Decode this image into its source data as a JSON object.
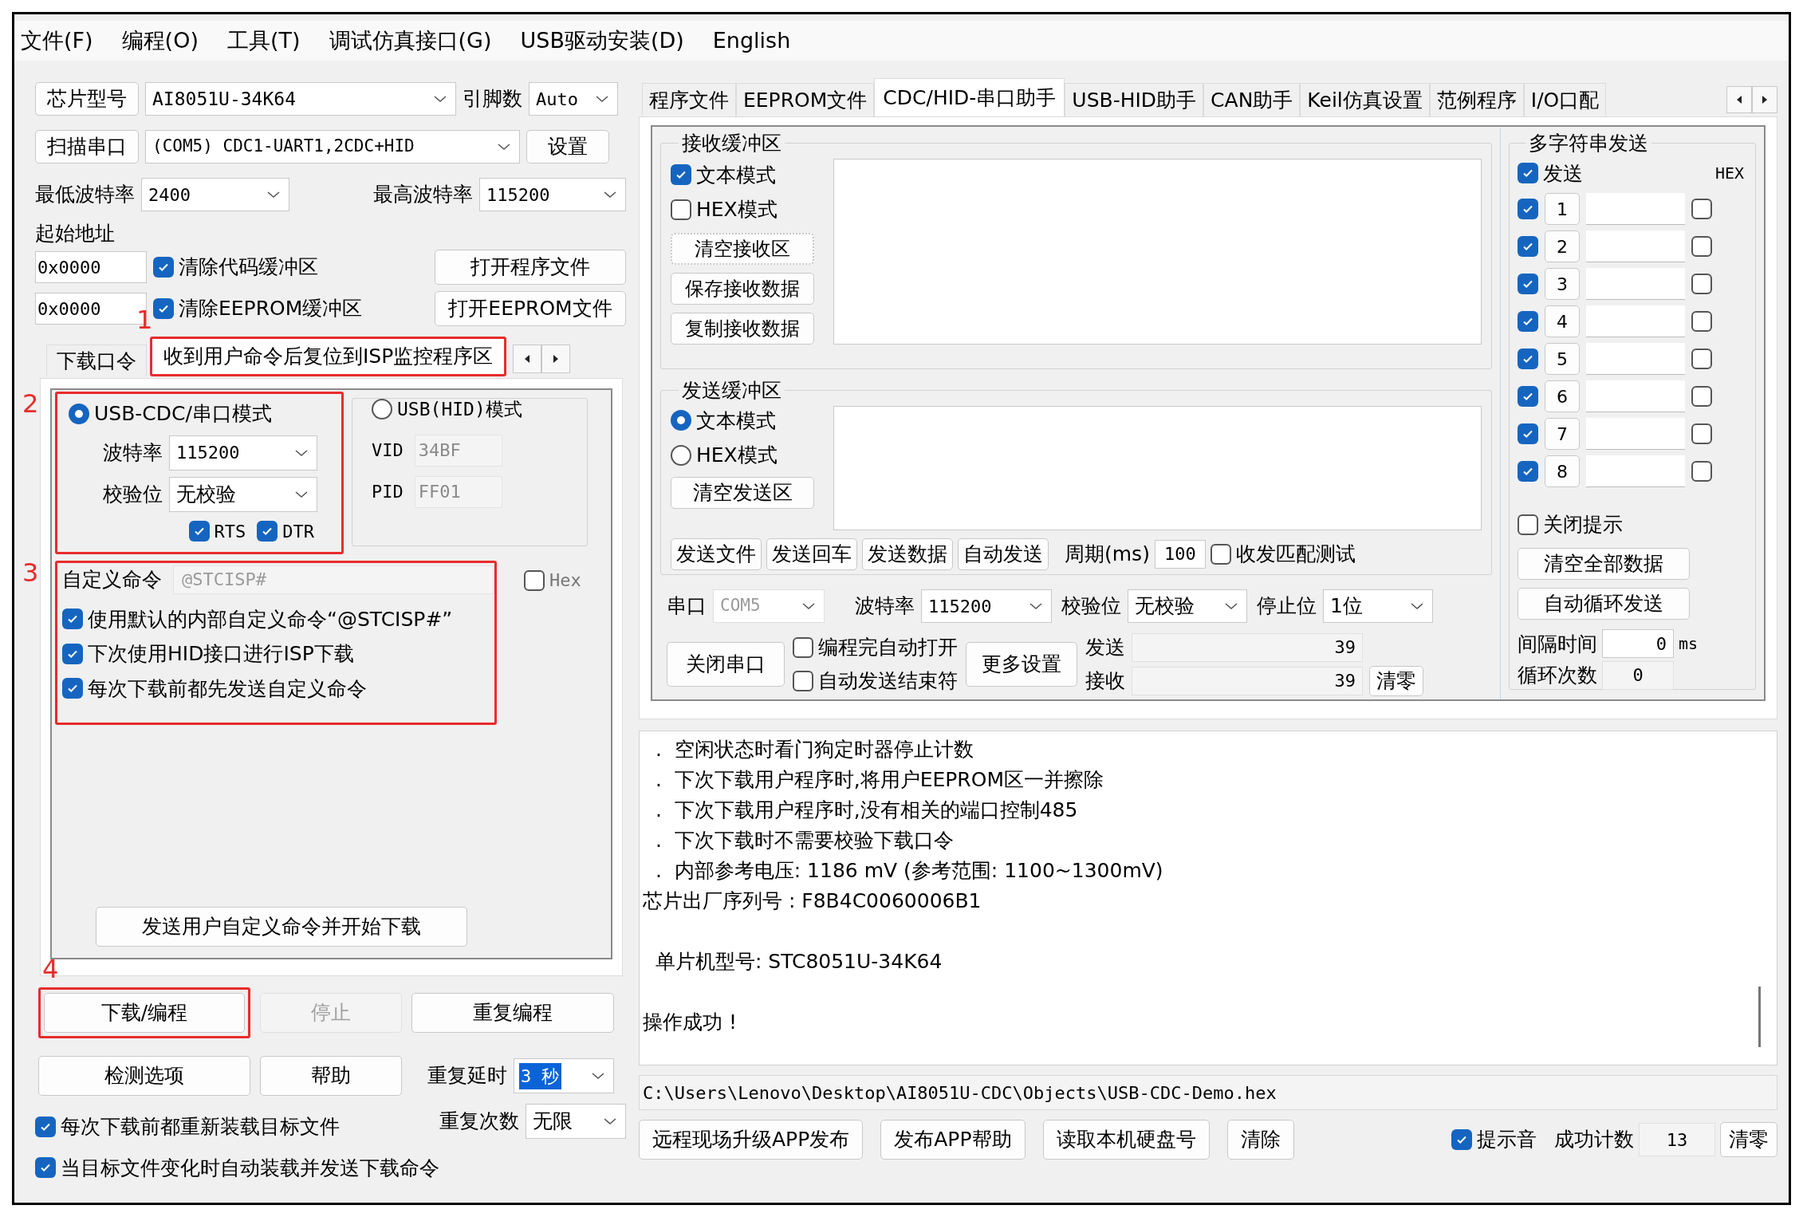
{
  "menu": [
    "文件(F)",
    "编程(O)",
    "工具(T)",
    "调试仿真接口(G)",
    "USB驱动安装(D)",
    "English"
  ],
  "annotations": [
    "1",
    "2",
    "3",
    "4"
  ],
  "left": {
    "chip": {
      "button": "芯片型号",
      "value": "AI8051U-34K64",
      "pins_label": "引脚数",
      "pins_value": "Auto"
    },
    "port": {
      "button": "扫描串口",
      "value": "(COM5) CDC1-UART1,2CDC+HID",
      "settings_button": "设置"
    },
    "baud": {
      "min_label": "最低波特率",
      "min_value": "2400",
      "max_label": "最高波特率",
      "max_value": "115200"
    },
    "start_address_label": "起始地址",
    "address_rows": [
      {
        "value": "0x0000",
        "label": "清除代码缓冲区",
        "checked": true,
        "button": "打开程序文件"
      },
      {
        "value": "0x0000",
        "label": "清除EEPROM缓冲区",
        "checked": true,
        "button": "打开EEPROM文件"
      }
    ],
    "tabs": [
      {
        "label": "下载口令",
        "selected": false
      },
      {
        "label": "收到用户命令后复位到ISP监控程序区",
        "selected": true
      }
    ],
    "mode_cdc": {
      "label": "USB-CDC/串口模式",
      "selected": true,
      "baud_label": "波特率",
      "baud_value": "115200",
      "parity_label": "校验位",
      "parity_value": "无校验",
      "flags": [
        {
          "label": "RTS",
          "checked": true
        },
        {
          "label": "DTR",
          "checked": true
        }
      ]
    },
    "mode_hid": {
      "label": "USB(HID)模式",
      "selected": false,
      "vid_label": "VID",
      "vid_value": "34BF",
      "pid_label": "PID",
      "pid_value": "FF01"
    },
    "custom_command": {
      "label": "自定义命令",
      "placeholder": "@STCISP#",
      "hex_label": "Hex",
      "hex_checked": false
    },
    "options": [
      {
        "label": "使用默认的内部自定义命令“@STCISP#”",
        "checked": true
      },
      {
        "label": "下次使用HID接口进行ISP下载",
        "checked": true
      },
      {
        "label": "每次下载前都先发送自定义命令",
        "checked": true
      }
    ],
    "send_button": "发送用户自定义命令并开始下载",
    "actions": [
      {
        "label": "下载/编程",
        "disabled": false
      },
      {
        "label": "停止",
        "disabled": true
      },
      {
        "label": "重复编程",
        "disabled": false
      },
      {
        "label": "检测选项",
        "disabled": false
      },
      {
        "label": "帮助",
        "disabled": false
      }
    ],
    "repeat_delay": {
      "label": "重复延时",
      "value": "3 秒",
      "highlighted": true
    },
    "repeat_count": {
      "label": "重复次数",
      "value": "无限",
      "highlighted": false
    },
    "bottom_options": [
      {
        "label": "每次下载前都重新装载目标文件",
        "checked": true
      },
      {
        "label": "当目标文件变化时自动装载并发送下载命令",
        "checked": true
      }
    ]
  },
  "right": {
    "tabs": [
      {
        "label": "程序文件",
        "selected": false
      },
      {
        "label": "EEPROM文件",
        "selected": false
      },
      {
        "label": "CDC/HID-串口助手",
        "selected": true
      },
      {
        "label": "USB-HID助手",
        "selected": false
      },
      {
        "label": "CAN助手",
        "selected": false
      },
      {
        "label": "Keil仿真设置",
        "selected": false
      },
      {
        "label": "范例程序",
        "selected": false
      },
      {
        "label": "I/O口配",
        "selected": false
      }
    ],
    "receive": {
      "title": "接收缓冲区",
      "modes": [
        {
          "label": "文本模式",
          "checked": true
        },
        {
          "label": "HEX模式",
          "checked": false
        }
      ],
      "buttons": [
        "清空接收区",
        "保存接收数据",
        "复制接收数据"
      ]
    },
    "send": {
      "title": "发送缓冲区",
      "modes": [
        {
          "label": "文本模式",
          "selected": true
        },
        {
          "label": "HEX模式",
          "selected": false
        }
      ],
      "clear_button": "清空发送区",
      "buttons": [
        "发送文件",
        "发送回车",
        "发送数据",
        "自动发送"
      ],
      "period_label": "周期(ms)",
      "period_value": "100",
      "match_test": {
        "label": "收发匹配测试",
        "checked": false
      }
    },
    "serial": {
      "port_label": "串口",
      "port_value": "COM5",
      "baud_label": "波特率",
      "baud_value": "115200",
      "parity_label": "校验位",
      "parity_value": "无校验",
      "stop_label": "停止位",
      "stop_value": "1位"
    },
    "close_button": "关闭串口",
    "auto_options": [
      {
        "label": "编程完自动打开",
        "checked": false
      },
      {
        "label": "自动发送结束符",
        "checked": false
      }
    ],
    "more_button": "更多设置",
    "counters": [
      {
        "label": "发送",
        "value": "39"
      },
      {
        "label": "接收",
        "value": "39"
      }
    ],
    "reset_button": "清零",
    "multi": {
      "title": "多字符串发送",
      "send": {
        "label": "发送",
        "checked": true
      },
      "hex_label": "HEX",
      "rows": [
        {
          "number": "1",
          "checked": true,
          "hex": false
        },
        {
          "number": "2",
          "checked": true,
          "hex": false
        },
        {
          "number": "3",
          "checked": true,
          "hex": false
        },
        {
          "number": "4",
          "checked": true,
          "hex": false
        },
        {
          "number": "5",
          "checked": true,
          "hex": false
        },
        {
          "number": "6",
          "checked": true,
          "hex": false
        },
        {
          "number": "7",
          "checked": true,
          "hex": false
        },
        {
          "number": "8",
          "checked": true,
          "hex": false
        }
      ],
      "close_hint": {
        "label": "关闭提示",
        "checked": false
      },
      "buttons": [
        "清空全部数据",
        "自动循环发送"
      ],
      "interval_label": "间隔时间",
      "interval_value": "0",
      "interval_unit": "ms",
      "loop_label": "循环次数",
      "loop_value": "0"
    }
  },
  "log_blocks": [
    [
      "  .  空闲状态时看门狗定时器停止计数",
      "  .  下次下载用户程序时,将用户EEPROM区一并擦除",
      "  .  下次下载用户程序时,没有相关的端口控制485",
      "  .  下次下载时不需要校验下载口令",
      "  .  内部参考电压: 1186 mV (参考范围: 1100~1300mV)",
      "芯片出厂序列号 : F8B4C0060006B1"
    ],
    [
      "  单片机型号: STC8051U-34K64"
    ],
    [
      "操作成功 !"
    ]
  ],
  "path": "C:\\Users\\Lenovo\\Desktop\\AI8051U-CDC\\Objects\\USB-CDC-Demo.hex",
  "bottom": {
    "buttons": [
      "远程现场升级APP发布",
      "发布APP帮助",
      "读取本机硬盘号",
      "清除"
    ],
    "sound": {
      "label": "提示音",
      "checked": true
    },
    "count_label": "成功计数",
    "count_value": "13",
    "reset_button": "清零"
  }
}
